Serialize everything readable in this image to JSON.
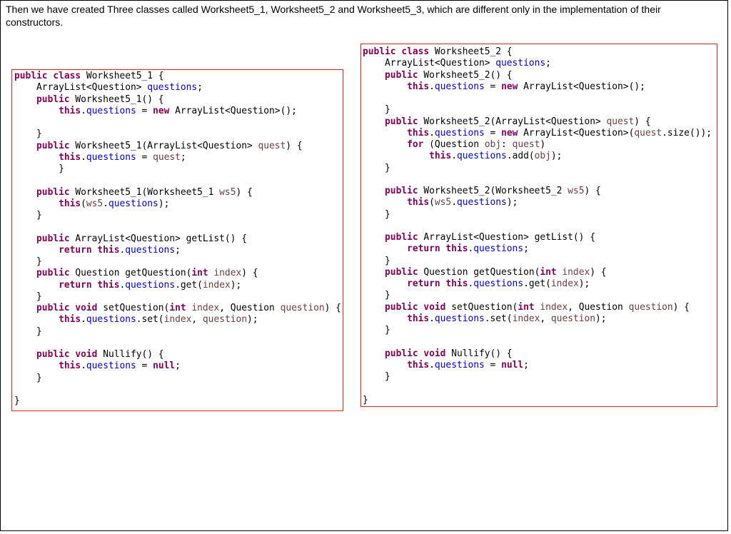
{
  "intro_text": "Then we have created Three classes called Worksheet5_1, Worksheet5_2 and Worksheet5_3, which are different only in the implementation of their constructors.",
  "code_left": [
    [
      [
        "kw",
        "public class "
      ],
      [
        "typ",
        "Worksheet5_1 {"
      ]
    ],
    [
      [
        "typ",
        "    ArrayList<Question> "
      ],
      [
        "fld",
        "questions"
      ],
      [
        "typ",
        ";"
      ]
    ],
    [
      [
        "kw",
        "    public "
      ],
      [
        "typ",
        "Worksheet5_1() {"
      ]
    ],
    [
      [
        "kw",
        "        this"
      ],
      [
        "typ",
        "."
      ],
      [
        "fld",
        "questions"
      ],
      [
        "typ",
        " = "
      ],
      [
        "kw",
        "new "
      ],
      [
        "typ",
        "ArrayList<Question>();"
      ]
    ],
    [
      [
        "typ",
        ""
      ]
    ],
    [
      [
        "typ",
        "    }"
      ]
    ],
    [
      [
        "kw",
        "    public "
      ],
      [
        "typ",
        "Worksheet5_1(ArrayList<Question> "
      ],
      [
        "par",
        "quest"
      ],
      [
        "typ",
        ") {"
      ]
    ],
    [
      [
        "kw",
        "        this"
      ],
      [
        "typ",
        "."
      ],
      [
        "fld",
        "questions"
      ],
      [
        "typ",
        " = "
      ],
      [
        "par",
        "quest"
      ],
      [
        "typ",
        ";"
      ]
    ],
    [
      [
        "typ",
        "        }"
      ]
    ],
    [
      [
        "typ",
        ""
      ]
    ],
    [
      [
        "kw",
        "    public "
      ],
      [
        "typ",
        "Worksheet5_1(Worksheet5_1 "
      ],
      [
        "par",
        "ws5"
      ],
      [
        "typ",
        ") {"
      ]
    ],
    [
      [
        "kw",
        "        this"
      ],
      [
        "typ",
        "("
      ],
      [
        "par",
        "ws5"
      ],
      [
        "typ",
        "."
      ],
      [
        "fld",
        "questions"
      ],
      [
        "typ",
        ");"
      ]
    ],
    [
      [
        "typ",
        "    }"
      ]
    ],
    [
      [
        "typ",
        ""
      ]
    ],
    [
      [
        "kw",
        "    public "
      ],
      [
        "typ",
        "ArrayList<Question> getList() {"
      ]
    ],
    [
      [
        "kw",
        "        return this"
      ],
      [
        "typ",
        "."
      ],
      [
        "fld",
        "questions"
      ],
      [
        "typ",
        ";"
      ]
    ],
    [
      [
        "typ",
        "    }"
      ]
    ],
    [
      [
        "kw",
        "    public "
      ],
      [
        "typ",
        "Question getQuestion("
      ],
      [
        "kw",
        "int "
      ],
      [
        "par",
        "index"
      ],
      [
        "typ",
        ") {"
      ]
    ],
    [
      [
        "kw",
        "        return this"
      ],
      [
        "typ",
        "."
      ],
      [
        "fld",
        "questions"
      ],
      [
        "typ",
        ".get("
      ],
      [
        "par",
        "index"
      ],
      [
        "typ",
        ");"
      ]
    ],
    [
      [
        "typ",
        "    }"
      ]
    ],
    [
      [
        "kw",
        "    public void "
      ],
      [
        "typ",
        "setQuestion("
      ],
      [
        "kw",
        "int "
      ],
      [
        "par",
        "index"
      ],
      [
        "typ",
        ", Question "
      ],
      [
        "par",
        "question"
      ],
      [
        "typ",
        ") {"
      ]
    ],
    [
      [
        "kw",
        "        this"
      ],
      [
        "typ",
        "."
      ],
      [
        "fld",
        "questions"
      ],
      [
        "typ",
        ".set("
      ],
      [
        "par",
        "index"
      ],
      [
        "typ",
        ", "
      ],
      [
        "par",
        "question"
      ],
      [
        "typ",
        ");"
      ]
    ],
    [
      [
        "typ",
        "    }"
      ]
    ],
    [
      [
        "typ",
        ""
      ]
    ],
    [
      [
        "kw",
        "    public void "
      ],
      [
        "typ",
        "Nullify() {"
      ]
    ],
    [
      [
        "kw",
        "        this"
      ],
      [
        "typ",
        "."
      ],
      [
        "fld",
        "questions"
      ],
      [
        "typ",
        " = "
      ],
      [
        "kw",
        "null"
      ],
      [
        "typ",
        ";"
      ]
    ],
    [
      [
        "typ",
        "    }"
      ]
    ],
    [
      [
        "typ",
        ""
      ]
    ],
    [
      [
        "typ",
        "}"
      ]
    ]
  ],
  "code_right": [
    [
      [
        "kw",
        "public class "
      ],
      [
        "typ",
        "Worksheet5_2 {"
      ]
    ],
    [
      [
        "typ",
        "    ArrayList<Question> "
      ],
      [
        "fld",
        "questions"
      ],
      [
        "typ",
        ";"
      ]
    ],
    [
      [
        "kw",
        "    public "
      ],
      [
        "typ",
        "Worksheet5_2() {"
      ]
    ],
    [
      [
        "kw",
        "        this"
      ],
      [
        "typ",
        "."
      ],
      [
        "fld",
        "questions"
      ],
      [
        "typ",
        " = "
      ],
      [
        "kw",
        "new "
      ],
      [
        "typ",
        "ArrayList<Question>();"
      ]
    ],
    [
      [
        "typ",
        ""
      ]
    ],
    [
      [
        "typ",
        "    }"
      ]
    ],
    [
      [
        "kw",
        "    public "
      ],
      [
        "typ",
        "Worksheet5_2(ArrayList<Question> "
      ],
      [
        "par",
        "quest"
      ],
      [
        "typ",
        ") {"
      ]
    ],
    [
      [
        "kw",
        "        this"
      ],
      [
        "typ",
        "."
      ],
      [
        "fld",
        "questions"
      ],
      [
        "typ",
        " = "
      ],
      [
        "kw",
        "new "
      ],
      [
        "typ",
        "ArrayList<Question>("
      ],
      [
        "par",
        "quest"
      ],
      [
        "typ",
        ".size());"
      ]
    ],
    [
      [
        "kw",
        "        for "
      ],
      [
        "typ",
        "(Question "
      ],
      [
        "par",
        "obj"
      ],
      [
        "typ",
        ": "
      ],
      [
        "par",
        "quest"
      ],
      [
        "typ",
        ")"
      ]
    ],
    [
      [
        "kw",
        "            this"
      ],
      [
        "typ",
        "."
      ],
      [
        "fld",
        "questions"
      ],
      [
        "typ",
        ".add("
      ],
      [
        "par",
        "obj"
      ],
      [
        "typ",
        ");"
      ]
    ],
    [
      [
        "typ",
        "    }"
      ]
    ],
    [
      [
        "typ",
        ""
      ]
    ],
    [
      [
        "kw",
        "    public "
      ],
      [
        "typ",
        "Worksheet5_2(Worksheet5_2 "
      ],
      [
        "par",
        "ws5"
      ],
      [
        "typ",
        ") {"
      ]
    ],
    [
      [
        "kw",
        "        this"
      ],
      [
        "typ",
        "("
      ],
      [
        "par",
        "ws5"
      ],
      [
        "typ",
        "."
      ],
      [
        "fld",
        "questions"
      ],
      [
        "typ",
        ");"
      ]
    ],
    [
      [
        "typ",
        "    }"
      ]
    ],
    [
      [
        "typ",
        ""
      ]
    ],
    [
      [
        "kw",
        "    public "
      ],
      [
        "typ",
        "ArrayList<Question> getList() {"
      ]
    ],
    [
      [
        "kw",
        "        return this"
      ],
      [
        "typ",
        "."
      ],
      [
        "fld",
        "questions"
      ],
      [
        "typ",
        ";"
      ]
    ],
    [
      [
        "typ",
        "    }"
      ]
    ],
    [
      [
        "kw",
        "    public "
      ],
      [
        "typ",
        "Question getQuestion("
      ],
      [
        "kw",
        "int "
      ],
      [
        "par",
        "index"
      ],
      [
        "typ",
        ") {"
      ]
    ],
    [
      [
        "kw",
        "        return this"
      ],
      [
        "typ",
        "."
      ],
      [
        "fld",
        "questions"
      ],
      [
        "typ",
        ".get("
      ],
      [
        "par",
        "index"
      ],
      [
        "typ",
        ");"
      ]
    ],
    [
      [
        "typ",
        "    }"
      ]
    ],
    [
      [
        "kw",
        "    public void "
      ],
      [
        "typ",
        "setQuestion("
      ],
      [
        "kw",
        "int "
      ],
      [
        "par",
        "index"
      ],
      [
        "typ",
        ", Question "
      ],
      [
        "par",
        "question"
      ],
      [
        "typ",
        ") {"
      ]
    ],
    [
      [
        "kw",
        "        this"
      ],
      [
        "typ",
        "."
      ],
      [
        "fld",
        "questions"
      ],
      [
        "typ",
        ".set("
      ],
      [
        "par",
        "index"
      ],
      [
        "typ",
        ", "
      ],
      [
        "par",
        "question"
      ],
      [
        "typ",
        ");"
      ]
    ],
    [
      [
        "typ",
        "    }"
      ]
    ],
    [
      [
        "typ",
        ""
      ]
    ],
    [
      [
        "kw",
        "    public void "
      ],
      [
        "typ",
        "Nullify() {"
      ]
    ],
    [
      [
        "kw",
        "        this"
      ],
      [
        "typ",
        "."
      ],
      [
        "fld",
        "questions"
      ],
      [
        "typ",
        " = "
      ],
      [
        "kw",
        "null"
      ],
      [
        "typ",
        ";"
      ]
    ],
    [
      [
        "typ",
        "    }"
      ]
    ],
    [
      [
        "typ",
        ""
      ]
    ],
    [
      [
        "typ",
        "}"
      ]
    ]
  ],
  "colors": {
    "keyword": "#7f0055",
    "field": "#0000c0",
    "parameter": "#6a3e3e",
    "box_border": "#e0201f"
  }
}
